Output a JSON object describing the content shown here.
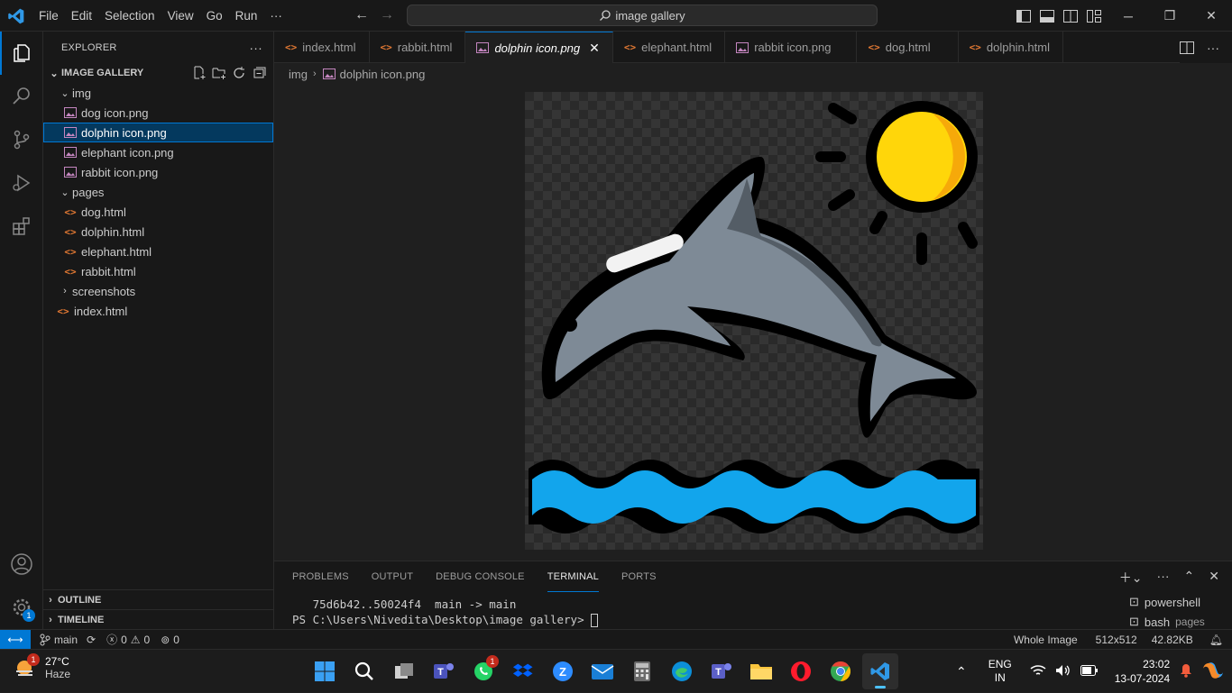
{
  "titlebar": {
    "menu": [
      "File",
      "Edit",
      "Selection",
      "View",
      "Go",
      "Run",
      "···"
    ],
    "search_text": "image gallery"
  },
  "explorer": {
    "header": "EXPLORER",
    "root": "IMAGE GALLERY",
    "tree": {
      "img": "img",
      "img_files": [
        "dog icon.png",
        "dolphin icon.png",
        "elephant icon.png",
        "rabbit icon.png"
      ],
      "pages": "pages",
      "page_files": [
        "dog.html",
        "dolphin.html",
        "elephant.html",
        "rabbit.html"
      ],
      "screenshots": "screenshots",
      "index": "index.html"
    },
    "outline": "OUTLINE",
    "timeline": "TIMELINE"
  },
  "tabs": [
    {
      "label": "index.html",
      "type": "html"
    },
    {
      "label": "rabbit.html",
      "type": "html"
    },
    {
      "label": "dolphin icon.png",
      "type": "image",
      "active": true
    },
    {
      "label": "elephant.html",
      "type": "html"
    },
    {
      "label": "rabbit icon.png",
      "type": "image"
    },
    {
      "label": "dog.html",
      "type": "html"
    },
    {
      "label": "dolphin.html",
      "type": "html"
    }
  ],
  "breadcrumb": {
    "folder": "img",
    "file": "dolphin icon.png"
  },
  "panel": {
    "tabs": [
      "PROBLEMS",
      "OUTPUT",
      "DEBUG CONSOLE",
      "TERMINAL",
      "PORTS"
    ],
    "active_tab": "TERMINAL",
    "terminal_line1": "   75d6b42..50024f4  main -> main",
    "terminal_prompt": "PS C:\\Users\\Nivedita\\Desktop\\image gallery> ",
    "terminals": [
      {
        "name": "powershell",
        "sub": ""
      },
      {
        "name": "bash",
        "sub": "pages"
      }
    ]
  },
  "statusbar": {
    "branch": "main",
    "errors": "0",
    "warnings": "0",
    "ports": "0",
    "view_mode": "Whole Image",
    "dimensions": "512x512",
    "file_size": "42.82KB"
  },
  "taskbar": {
    "temperature": "27°C",
    "weather": "Haze",
    "weather_badge": "1",
    "whatsapp_badge": "1",
    "lang_top": "ENG",
    "lang_bottom": "IN",
    "time": "23:02",
    "date": "13-07-2024"
  },
  "accounts_badge": "1",
  "colors": {
    "accent": "#0078d4",
    "html_icon": "#e37933",
    "image_icon": "#c586c0"
  }
}
